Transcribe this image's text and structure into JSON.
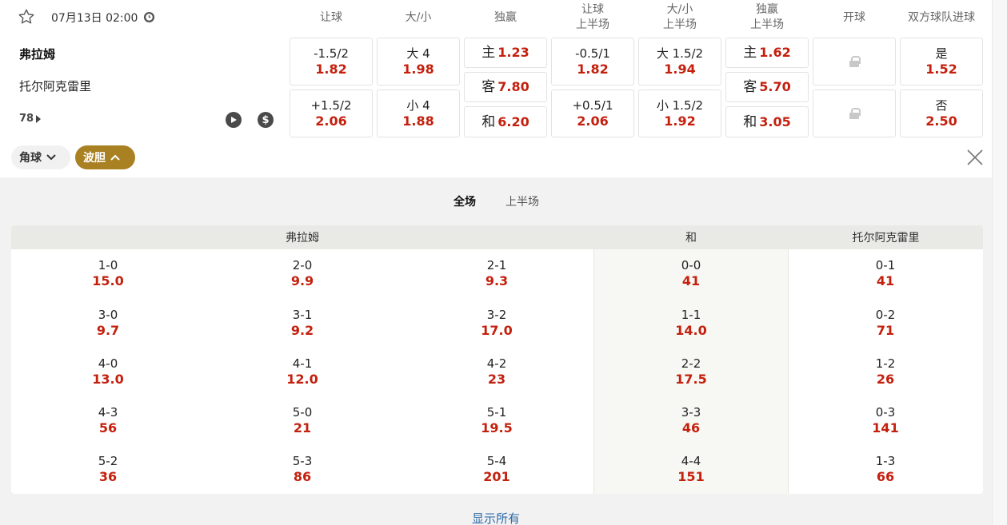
{
  "match": {
    "date_time": "07月13日 02:00",
    "home": "弗拉姆",
    "away": "托尔阿克雷里",
    "more_markets": "78"
  },
  "icons": {
    "favorite": "star-icon",
    "live_clock": "clock-icon",
    "play": "play-icon",
    "cashout": "dollar-icon",
    "lock": "lock-icon",
    "close": "close-icon",
    "chevron_down": "chevron-down-icon",
    "chevron_up": "chevron-up-icon",
    "more": "caret-right-icon"
  },
  "columns": [
    {
      "line1": "让球",
      "line2": ""
    },
    {
      "line1": "大/小",
      "line2": ""
    },
    {
      "line1": "独赢",
      "line2": ""
    },
    {
      "line1": "让球",
      "line2": "上半场"
    },
    {
      "line1": "大/小",
      "line2": "上半场"
    },
    {
      "line1": "独赢",
      "line2": "上半场"
    },
    {
      "line1": "开球",
      "line2": ""
    },
    {
      "line1": "双方球队进球",
      "line2": ""
    }
  ],
  "odds": {
    "handicap": [
      {
        "label": "-1.5/2",
        "odd": "1.82"
      },
      {
        "label": "+1.5/2",
        "odd": "2.06"
      }
    ],
    "total": [
      {
        "label": "大 4",
        "odd": "1.98"
      },
      {
        "label": "小 4",
        "odd": "1.88"
      }
    ],
    "moneyline": [
      {
        "label": "主",
        "odd": "1.23"
      },
      {
        "label": "客",
        "odd": "7.80"
      },
      {
        "label": "和",
        "odd": "6.20"
      }
    ],
    "handicap_1h": [
      {
        "label": "-0.5/1",
        "odd": "1.82"
      },
      {
        "label": "+0.5/1",
        "odd": "2.06"
      }
    ],
    "total_1h": [
      {
        "label": "大 1.5/2",
        "odd": "1.94"
      },
      {
        "label": "小 1.5/2",
        "odd": "1.92"
      }
    ],
    "moneyline_1h": [
      {
        "label": "主",
        "odd": "1.62"
      },
      {
        "label": "客",
        "odd": "5.70"
      },
      {
        "label": "和",
        "odd": "3.05"
      }
    ],
    "btts": [
      {
        "label": "是",
        "odd": "1.52"
      },
      {
        "label": "否",
        "odd": "2.50"
      }
    ]
  },
  "filters": {
    "corners": "角球",
    "correct_score": "波胆"
  },
  "correct_score": {
    "tabs": [
      "全场",
      "上半场"
    ],
    "headers": {
      "home": "弗拉姆",
      "draw": "和",
      "away": "托尔阿克雷里"
    },
    "rows": [
      [
        {
          "s": "1-0",
          "o": "15.0"
        },
        {
          "s": "2-0",
          "o": "9.9"
        },
        {
          "s": "2-1",
          "o": "9.3"
        },
        {
          "s": "0-0",
          "o": "41"
        },
        {
          "s": "0-1",
          "o": "41"
        }
      ],
      [
        {
          "s": "3-0",
          "o": "9.7"
        },
        {
          "s": "3-1",
          "o": "9.2"
        },
        {
          "s": "3-2",
          "o": "17.0"
        },
        {
          "s": "1-1",
          "o": "14.0"
        },
        {
          "s": "0-2",
          "o": "71"
        }
      ],
      [
        {
          "s": "4-0",
          "o": "13.0"
        },
        {
          "s": "4-1",
          "o": "12.0"
        },
        {
          "s": "4-2",
          "o": "23"
        },
        {
          "s": "2-2",
          "o": "17.5"
        },
        {
          "s": "1-2",
          "o": "26"
        }
      ],
      [
        {
          "s": "4-3",
          "o": "56"
        },
        {
          "s": "5-0",
          "o": "21"
        },
        {
          "s": "5-1",
          "o": "19.5"
        },
        {
          "s": "3-3",
          "o": "46"
        },
        {
          "s": "0-3",
          "o": "141"
        }
      ],
      [
        {
          "s": "5-2",
          "o": "36"
        },
        {
          "s": "5-3",
          "o": "86"
        },
        {
          "s": "5-4",
          "o": "201"
        },
        {
          "s": "4-4",
          "o": "151"
        },
        {
          "s": "1-3",
          "o": "66"
        }
      ]
    ],
    "show_all": "显示所有"
  },
  "colors": {
    "odd": "#c4200e",
    "chip_active": "#a98022",
    "link": "#2d6aa6"
  }
}
